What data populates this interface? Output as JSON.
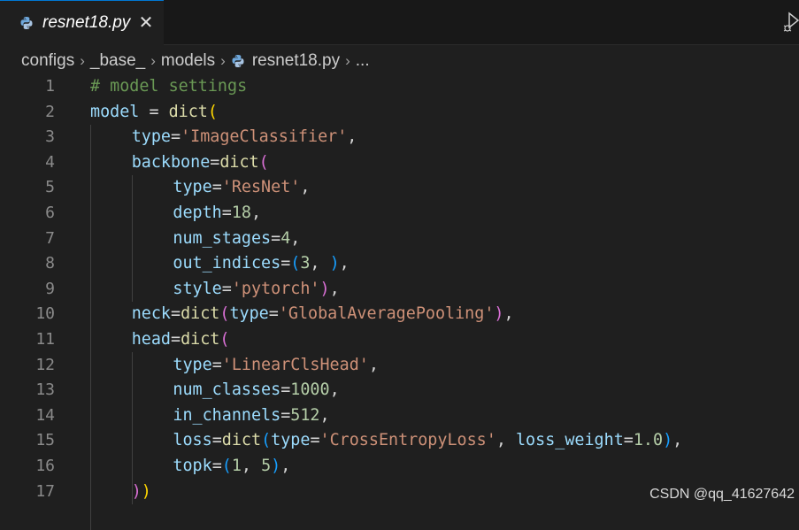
{
  "tab": {
    "filename": "resnet18.py",
    "close_glyph": "✕",
    "icon": "python-icon"
  },
  "breadcrumb": {
    "parts": [
      "configs",
      "_base_",
      "models",
      "resnet18.py",
      "..."
    ],
    "separator": "›"
  },
  "colors": {
    "comment": "#6a9955",
    "variable": "#9cdcfe",
    "function": "#dcdcaa",
    "string": "#ce9178",
    "number": "#b5cea8",
    "bracket1": "#ffd700",
    "bracket2": "#da70d6",
    "bracket3": "#179fff",
    "plain": "#d4d4d4"
  },
  "code_lines": [
    {
      "num": "1",
      "indent": 0,
      "tokens": [
        [
          "# model settings",
          "comment"
        ]
      ]
    },
    {
      "num": "2",
      "indent": 0,
      "tokens": [
        [
          "model",
          "variable"
        ],
        [
          " = ",
          "plain"
        ],
        [
          "dict",
          "function"
        ],
        [
          "(",
          "bracket1"
        ]
      ]
    },
    {
      "num": "3",
      "indent": 1,
      "tokens": [
        [
          "type",
          "variable"
        ],
        [
          "=",
          "plain"
        ],
        [
          "'ImageClassifier'",
          "string"
        ],
        [
          ",",
          "plain"
        ]
      ]
    },
    {
      "num": "4",
      "indent": 1,
      "tokens": [
        [
          "backbone",
          "variable"
        ],
        [
          "=",
          "plain"
        ],
        [
          "dict",
          "function"
        ],
        [
          "(",
          "bracket2"
        ]
      ]
    },
    {
      "num": "5",
      "indent": 2,
      "tokens": [
        [
          "type",
          "variable"
        ],
        [
          "=",
          "plain"
        ],
        [
          "'ResNet'",
          "string"
        ],
        [
          ",",
          "plain"
        ]
      ]
    },
    {
      "num": "6",
      "indent": 2,
      "tokens": [
        [
          "depth",
          "variable"
        ],
        [
          "=",
          "plain"
        ],
        [
          "18",
          "number"
        ],
        [
          ",",
          "plain"
        ]
      ]
    },
    {
      "num": "7",
      "indent": 2,
      "tokens": [
        [
          "num_stages",
          "variable"
        ],
        [
          "=",
          "plain"
        ],
        [
          "4",
          "number"
        ],
        [
          ",",
          "plain"
        ]
      ]
    },
    {
      "num": "8",
      "indent": 2,
      "tokens": [
        [
          "out_indices",
          "variable"
        ],
        [
          "=",
          "plain"
        ],
        [
          "(",
          "bracket3"
        ],
        [
          "3",
          "number"
        ],
        [
          ", ",
          "plain"
        ],
        [
          ")",
          "bracket3"
        ],
        [
          ",",
          "plain"
        ]
      ]
    },
    {
      "num": "9",
      "indent": 2,
      "tokens": [
        [
          "style",
          "variable"
        ],
        [
          "=",
          "plain"
        ],
        [
          "'pytorch'",
          "string"
        ],
        [
          ")",
          "bracket2"
        ],
        [
          ",",
          "plain"
        ]
      ]
    },
    {
      "num": "10",
      "indent": 1,
      "tokens": [
        [
          "neck",
          "variable"
        ],
        [
          "=",
          "plain"
        ],
        [
          "dict",
          "function"
        ],
        [
          "(",
          "bracket2"
        ],
        [
          "type",
          "variable"
        ],
        [
          "=",
          "plain"
        ],
        [
          "'GlobalAveragePooling'",
          "string"
        ],
        [
          ")",
          "bracket2"
        ],
        [
          ",",
          "plain"
        ]
      ]
    },
    {
      "num": "11",
      "indent": 1,
      "tokens": [
        [
          "head",
          "variable"
        ],
        [
          "=",
          "plain"
        ],
        [
          "dict",
          "function"
        ],
        [
          "(",
          "bracket2"
        ]
      ]
    },
    {
      "num": "12",
      "indent": 2,
      "tokens": [
        [
          "type",
          "variable"
        ],
        [
          "=",
          "plain"
        ],
        [
          "'LinearClsHead'",
          "string"
        ],
        [
          ",",
          "plain"
        ]
      ]
    },
    {
      "num": "13",
      "indent": 2,
      "tokens": [
        [
          "num_classes",
          "variable"
        ],
        [
          "=",
          "plain"
        ],
        [
          "1000",
          "number"
        ],
        [
          ",",
          "plain"
        ]
      ]
    },
    {
      "num": "14",
      "indent": 2,
      "tokens": [
        [
          "in_channels",
          "variable"
        ],
        [
          "=",
          "plain"
        ],
        [
          "512",
          "number"
        ],
        [
          ",",
          "plain"
        ]
      ]
    },
    {
      "num": "15",
      "indent": 2,
      "tokens": [
        [
          "loss",
          "variable"
        ],
        [
          "=",
          "plain"
        ],
        [
          "dict",
          "function"
        ],
        [
          "(",
          "bracket3"
        ],
        [
          "type",
          "variable"
        ],
        [
          "=",
          "plain"
        ],
        [
          "'CrossEntropyLoss'",
          "string"
        ],
        [
          ", ",
          "plain"
        ],
        [
          "loss_weight",
          "variable"
        ],
        [
          "=",
          "plain"
        ],
        [
          "1.0",
          "number"
        ],
        [
          ")",
          "bracket3"
        ],
        [
          ",",
          "plain"
        ]
      ]
    },
    {
      "num": "16",
      "indent": 2,
      "tokens": [
        [
          "topk",
          "variable"
        ],
        [
          "=",
          "plain"
        ],
        [
          "(",
          "bracket3"
        ],
        [
          "1",
          "number"
        ],
        [
          ", ",
          "plain"
        ],
        [
          "5",
          "number"
        ],
        [
          ")",
          "bracket3"
        ],
        [
          ",",
          "plain"
        ]
      ]
    },
    {
      "num": "17",
      "indent": 1,
      "tokens": [
        [
          ")",
          "bracket2"
        ],
        [
          ")",
          "bracket1"
        ]
      ]
    }
  ],
  "watermark": "CSDN @qq_41627642"
}
